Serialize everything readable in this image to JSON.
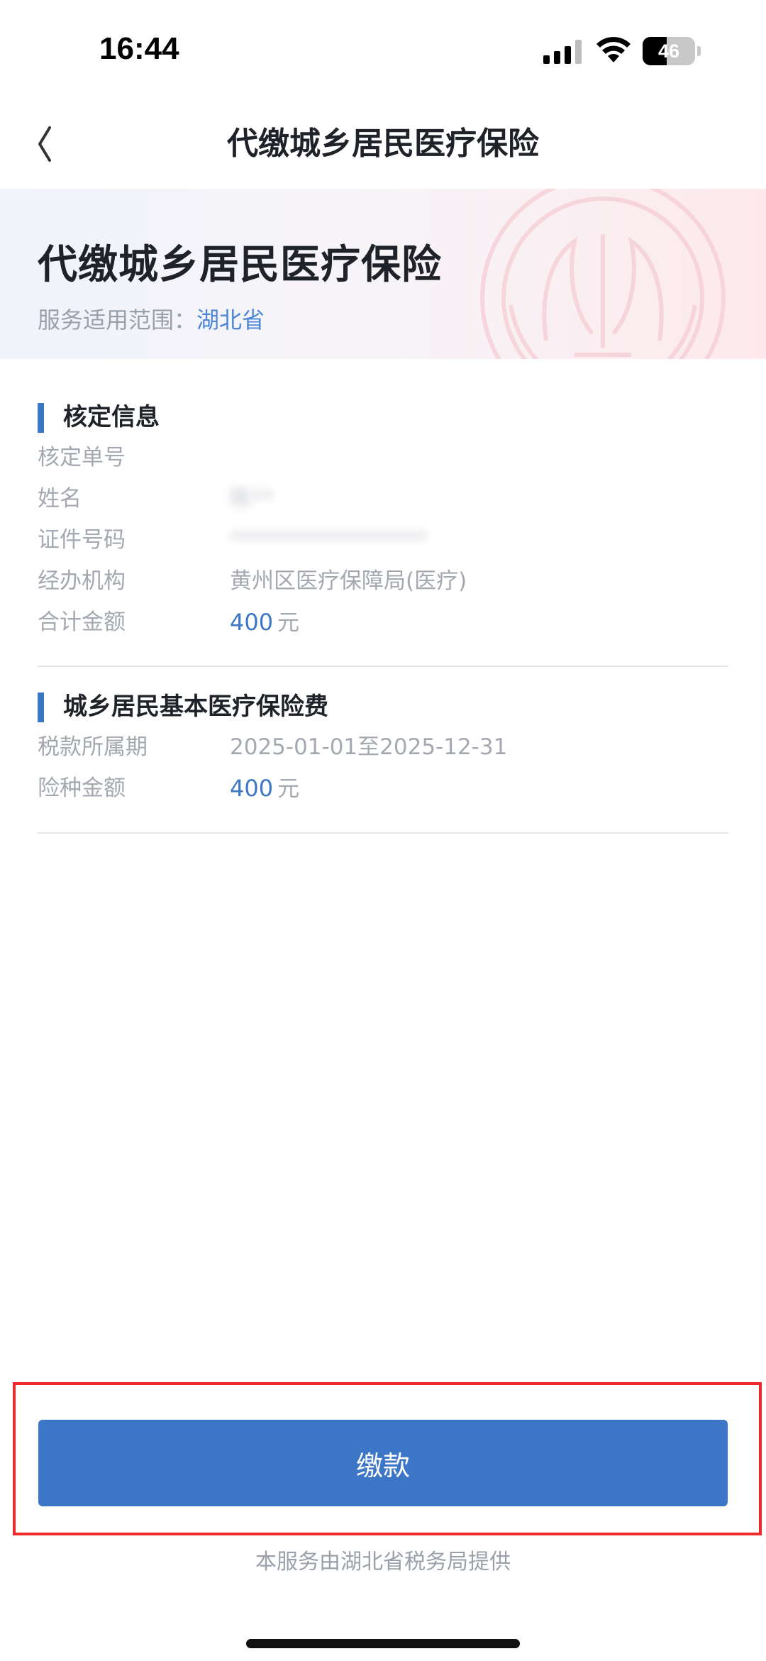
{
  "status_bar": {
    "time": "16:44",
    "battery_level": "46",
    "battery_fraction": 0.46,
    "icons": [
      "signal-icon",
      "wifi-icon",
      "battery-icon"
    ]
  },
  "nav": {
    "title": "代缴城乡居民医疗保险",
    "back_icon": "chevron-left-icon"
  },
  "banner": {
    "title": "代缴城乡居民医疗保险",
    "scope_label": "服务适用范围：",
    "scope_value": "湖北省",
    "emblem_icon": "tax-emblem-watermark"
  },
  "assessment": {
    "title": "核定信息",
    "rows": [
      {
        "label": "核定单号",
        "value": ""
      },
      {
        "label": "姓名",
        "value": "陈**"
      },
      {
        "label": "证件号码",
        "value": "******************"
      },
      {
        "label": "经办机构",
        "value": "黄州区医疗保障局(医疗)"
      },
      {
        "label": "合计金额",
        "amount": "400",
        "unit": "元"
      }
    ]
  },
  "premium": {
    "title": "城乡居民基本医疗保险费",
    "rows": [
      {
        "label": "税款所属期",
        "value": "2025-01-01至2025-12-31"
      },
      {
        "label": "险种金额",
        "amount": "400",
        "unit": "元"
      }
    ]
  },
  "actions": {
    "pay_label": "缴款"
  },
  "footer": {
    "provider_note": "本服务由湖北省税务局提供"
  },
  "colors": {
    "accent": "#3c76c6",
    "scope_link": "#4c86d6",
    "highlight": "#ee2a2a",
    "muted_text": "#a4a8b0"
  }
}
